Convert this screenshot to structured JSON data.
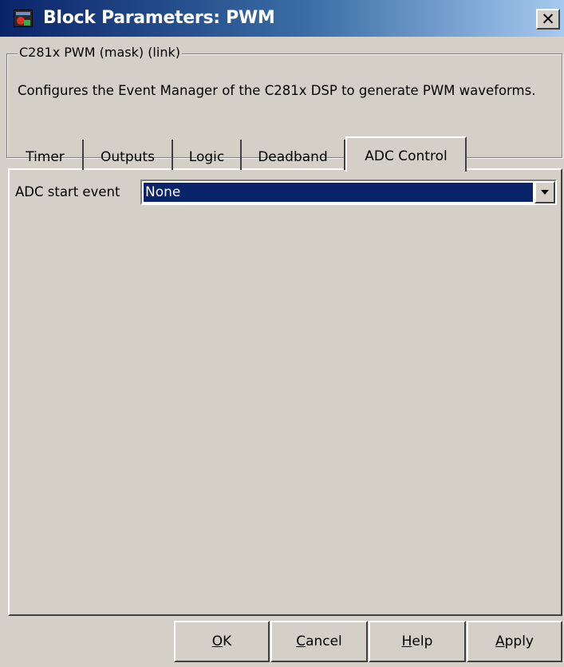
{
  "window": {
    "title": "Block Parameters: PWM",
    "close_label": "✕"
  },
  "group": {
    "legend": "C281x PWM (mask) (link)",
    "description": "Configures the Event Manager of the C281x DSP to generate PWM waveforms."
  },
  "tabs": [
    {
      "label": "Timer",
      "active": false
    },
    {
      "label": "Outputs",
      "active": false
    },
    {
      "label": "Logic",
      "active": false
    },
    {
      "label": "Deadband",
      "active": false
    },
    {
      "label": "ADC Control",
      "active": true
    }
  ],
  "adc_control": {
    "start_event_label": "ADC start event",
    "start_event_value": "None"
  },
  "buttons": {
    "ok": {
      "mnemonic": "O",
      "rest": "K"
    },
    "cancel": {
      "mnemonic": "C",
      "rest": "ancel"
    },
    "help": {
      "mnemonic": "H",
      "rest": "elp"
    },
    "apply": {
      "mnemonic": "A",
      "rest": "pply"
    }
  },
  "colors": {
    "titlebar_start": "#0a246a",
    "titlebar_end": "#a6caf0",
    "face": "#d4d0c8",
    "selection": "#0a246a"
  }
}
